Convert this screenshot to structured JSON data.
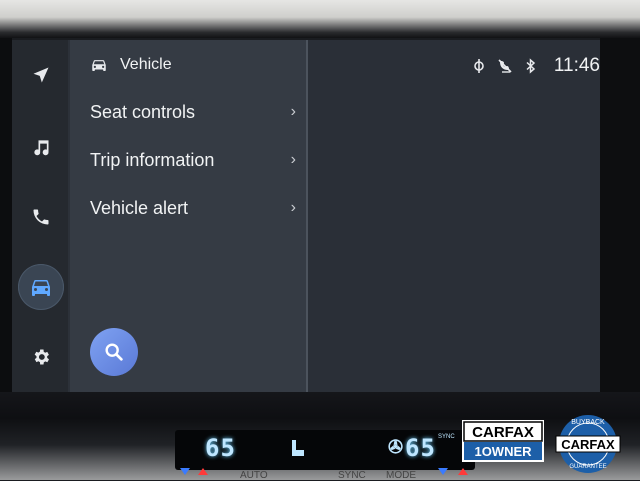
{
  "rail": {
    "items": [
      {
        "name": "navigation-icon"
      },
      {
        "name": "music-icon"
      },
      {
        "name": "phone-icon"
      },
      {
        "name": "vehicle-icon",
        "active": true
      },
      {
        "name": "settings-icon"
      }
    ],
    "active_color": "#5fa8ff"
  },
  "panel": {
    "title": "Vehicle",
    "items": [
      {
        "label": "Seat controls"
      },
      {
        "label": "Trip information"
      },
      {
        "label": "Vehicle alert"
      }
    ],
    "chevron": "›"
  },
  "status_bar": {
    "icons": [
      "wireless-charging-icon",
      "phone-muted-icon",
      "bluetooth-icon"
    ],
    "time": "11:46"
  },
  "climate": {
    "left_temp": "65",
    "right_temp": "65",
    "sync_label": "SYNC",
    "buttons": [
      "AUTO",
      "SYNC",
      "MODE"
    ]
  },
  "badges": {
    "carfax_one_owner": {
      "top": "CARFAX",
      "bottom": "1OWNER"
    },
    "carfax_buyback": {
      "arc_top": "BUYBACK",
      "center": "CARFAX",
      "arc_bottom": "GUARANTEE"
    }
  }
}
